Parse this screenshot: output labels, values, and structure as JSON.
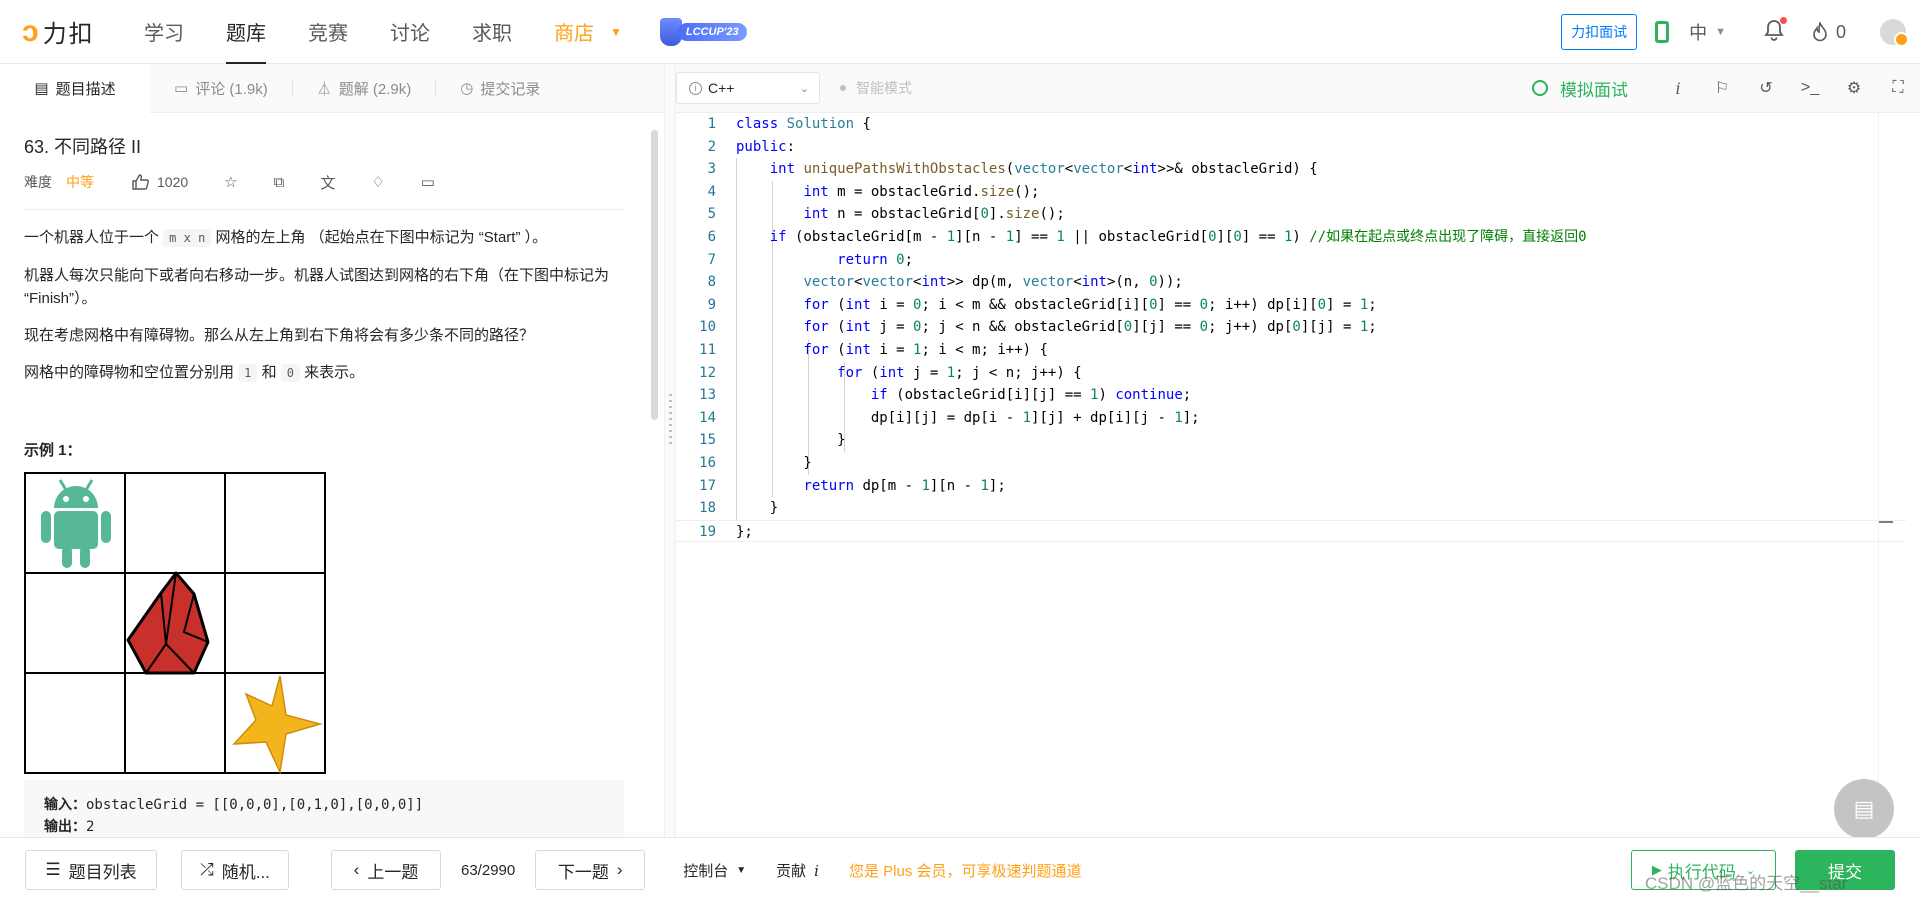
{
  "brand": {
    "logo_text": "力扣"
  },
  "topnav": {
    "items": [
      {
        "label": "学习"
      },
      {
        "label": "题库"
      },
      {
        "label": "竞赛"
      },
      {
        "label": "讨论"
      },
      {
        "label": "求职"
      },
      {
        "label": "商店"
      }
    ],
    "active_index": 1,
    "event_badge": "LCCUP'23",
    "mock_interview": "力扣面试",
    "language": "中",
    "streak_count": "0"
  },
  "left_tabs": [
    {
      "label": "题目描述",
      "icon": "description-icon"
    },
    {
      "label": "评论 (1.9k)",
      "icon": "comment-icon"
    },
    {
      "label": "题解 (2.9k)",
      "icon": "flask-icon"
    },
    {
      "label": "提交记录",
      "icon": "history-icon"
    }
  ],
  "problem": {
    "title": "63. 不同路径 II",
    "difficulty_label": "难度",
    "difficulty": "中等",
    "likes": "1020",
    "paragraphs": {
      "p1_prefix": "一个机器人位于一个 ",
      "p1_code": "m x n",
      "p1_suffix": " 网格的左上角 （起始点在下图中标记为 “Start” ）。",
      "p2": "机器人每次只能向下或者向右移动一步。机器人试图达到网格的右下角（在下图中标记为 “Finish”）。",
      "p3": "现在考虑网格中有障碍物。那么从左上角到右下角将会有多少条不同的路径？",
      "p4_prefix": "网格中的障碍物和空位置分别用 ",
      "p4_code1": "1",
      "p4_mid": " 和 ",
      "p4_code2": "0",
      "p4_suffix": " 来表示。"
    },
    "example_title": "示例 1：",
    "grid_obstacles": [
      [
        0,
        0,
        0
      ],
      [
        0,
        1,
        0
      ],
      [
        0,
        0,
        0
      ]
    ],
    "input_label": "输入：",
    "input_value": "obstacleGrid = [[0,0,0],[0,1,0],[0,0,0]]",
    "output_label": "输出：",
    "output_value": "2"
  },
  "editor": {
    "language": "C++",
    "smart_mode": "智能模式",
    "mock_interview": "模拟面试",
    "lines": [
      "class Solution {",
      "public:",
      "    int uniquePathsWithObstacles(vector<vector<int>>& obstacleGrid) {",
      "        int m = obstacleGrid.size();",
      "        int n = obstacleGrid[0].size();",
      "    if (obstacleGrid[m - 1][n - 1] == 1 || obstacleGrid[0][0] == 1) //如果在起点或终点出现了障碍，直接返回0",
      "            return 0;",
      "        vector<vector<int>> dp(m, vector<int>(n, 0));",
      "        for (int i = 0; i < m && obstacleGrid[i][0] == 0; i++) dp[i][0] = 1;",
      "        for (int j = 0; j < n && obstacleGrid[0][j] == 0; j++) dp[0][j] = 1;",
      "        for (int i = 1; i < m; i++) {",
      "            for (int j = 1; j < n; j++) {",
      "                if (obstacleGrid[i][j] == 1) continue;",
      "                dp[i][j] = dp[i - 1][j] + dp[i][j - 1];",
      "            }",
      "        }",
      "        return dp[m - 1][n - 1];",
      "    }",
      "};"
    ]
  },
  "bottom": {
    "problem_list": "题目列表",
    "random": "随机...",
    "prev": "上一题",
    "page": "63/2990",
    "next": "下一题",
    "console": "控制台",
    "contribute": "贡献",
    "plus_note": "您是 Plus 会员，可享极速判题通道",
    "run": "执行代码",
    "submit": "提交"
  },
  "watermark": "CSDN @蓝色的天空__star",
  "colors": {
    "accent": "#ffa116",
    "green": "#2db55d",
    "blue": "#007aff"
  }
}
